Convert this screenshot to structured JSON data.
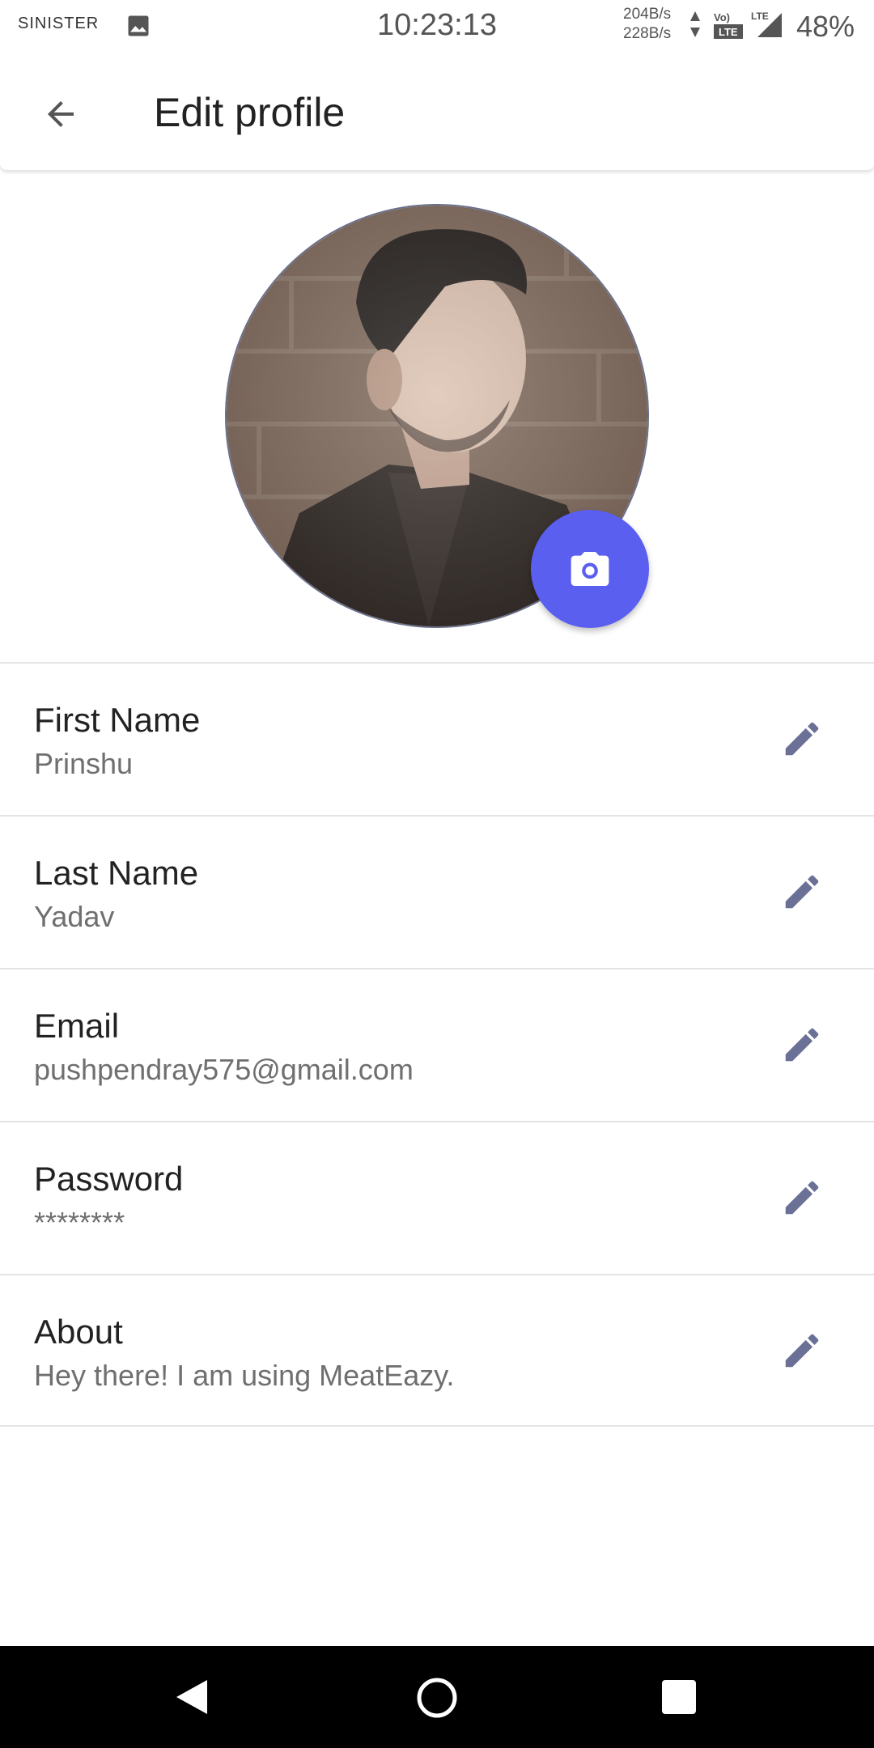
{
  "status_bar": {
    "carrier": "SINISTER",
    "time": "10:23:13",
    "speed_up": "204B/s",
    "speed_down": "228B/s",
    "battery": "48%"
  },
  "app_bar": {
    "title": "Edit profile"
  },
  "profile": {
    "avatar_accent": "#5b5ff0"
  },
  "fields": [
    {
      "label": "First Name",
      "value": "Prinshu"
    },
    {
      "label": "Last Name",
      "value": "Yadav"
    },
    {
      "label": "Email",
      "value": "pushpendray575@gmail.com"
    },
    {
      "label": "Password",
      "value": "********"
    },
    {
      "label": "About",
      "value": "Hey there! I am using MeatEazy."
    }
  ],
  "icons": {
    "back": "arrow-left-icon",
    "camera": "camera-icon",
    "edit": "pencil-icon"
  },
  "colors": {
    "accent": "#5b5ff0",
    "edit_icon": "#6b7196",
    "divider": "#e4e4e4"
  }
}
